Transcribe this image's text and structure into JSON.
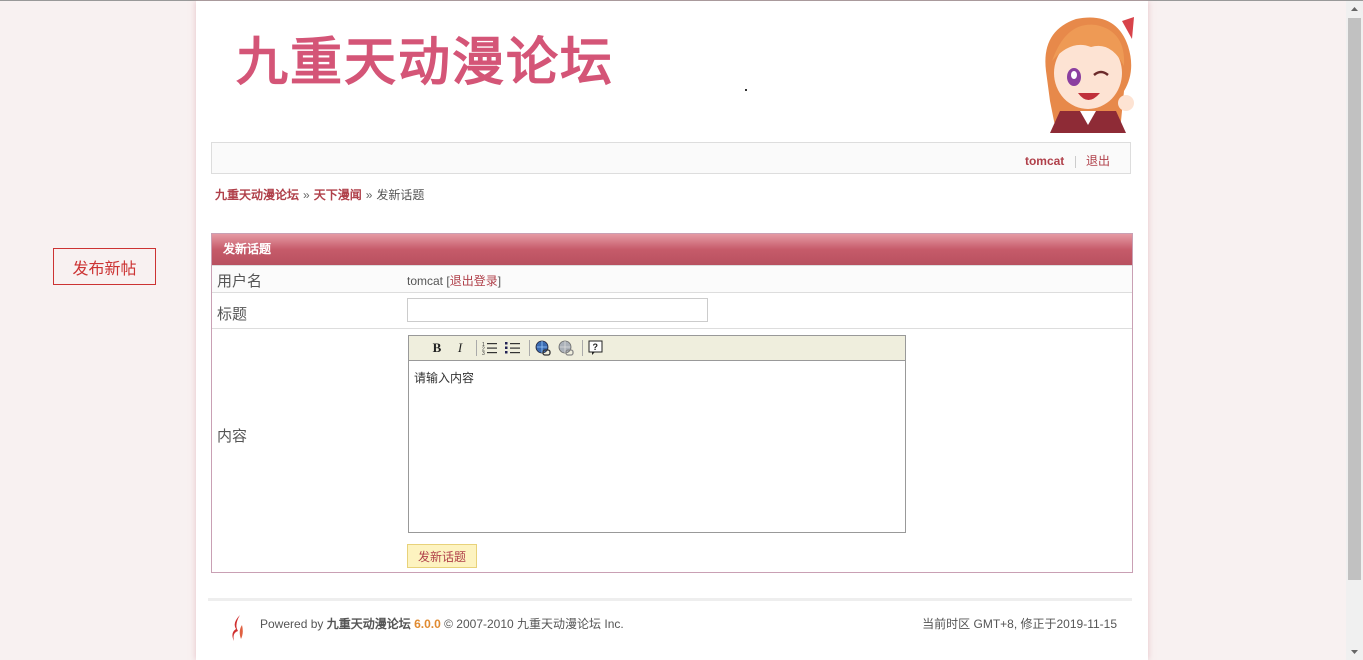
{
  "side_button": {
    "label": "发布新帖"
  },
  "header": {
    "logo_text": "九重天动漫论坛"
  },
  "userbar": {
    "username": "tomcat",
    "logout": "退出"
  },
  "breadcrumb": {
    "home": "九重天动漫论坛",
    "separator": "»",
    "forum": "天下漫闻",
    "current": "发新话题"
  },
  "form": {
    "title": "发新话题",
    "username_label": "用户名",
    "username_value": "tomcat",
    "logout_link": "退出登录",
    "subject_label": "标题",
    "subject_value": "",
    "content_label": "内容",
    "content_text": "请输入内容",
    "toolbar": [
      "bold-icon",
      "italic-icon",
      "ordered-list-icon",
      "unordered-list-icon",
      "link-icon",
      "unlink-icon",
      "help-icon"
    ],
    "submit_label": "发新话题"
  },
  "footer": {
    "powered_by": "Powered by",
    "brand": "九重天动漫论坛",
    "version": "6.0.0",
    "copyright": "© 2007-2010 九重天动漫论坛 Inc.",
    "timezone": "当前时区 GMT+8, 修正于2019-11-15"
  },
  "colors": {
    "accent": "#b0404a",
    "logo": "#d45577",
    "header_bar": "#c65b6a"
  }
}
